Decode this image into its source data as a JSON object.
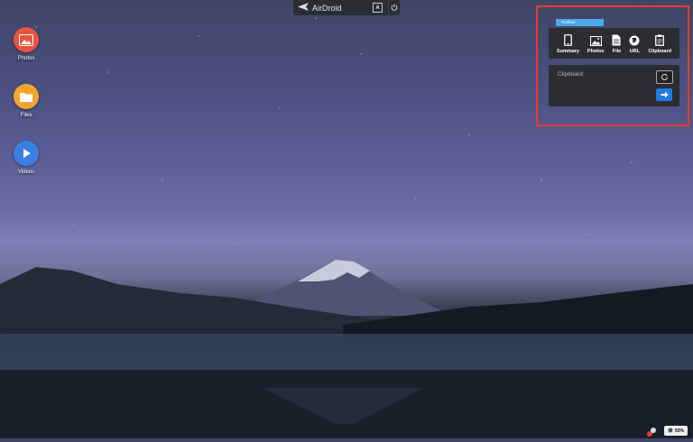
{
  "desktop": {
    "icons": [
      {
        "label": "Photos",
        "icon": "photos-icon",
        "color": "#e8553f"
      },
      {
        "label": "Files",
        "icon": "folder-icon",
        "color": "#f4a52e"
      },
      {
        "label": "Videos",
        "icon": "play-icon",
        "color": "#3d7fe0"
      }
    ]
  },
  "topbar": {
    "brand": "AirDroid",
    "icon": "airdroid-logo-icon",
    "mode_icon": "A",
    "power_icon": "power-icon"
  },
  "toolbox": {
    "label": "Toolbox",
    "items": [
      {
        "label": "Summary",
        "icon": "phone-icon"
      },
      {
        "label": "Photos",
        "icon": "image-icon"
      },
      {
        "label": "File",
        "icon": "file-icon"
      },
      {
        "label": "URL",
        "icon": "globe-icon"
      },
      {
        "label": "Clipboard",
        "icon": "clipboard-icon"
      }
    ],
    "clipboard": {
      "placeholder": "Clipboard",
      "refresh_icon": "refresh-icon",
      "send_icon": "arrow-right-icon"
    },
    "highlight_color": "#e53b2b"
  },
  "status": {
    "battery": "50%"
  }
}
